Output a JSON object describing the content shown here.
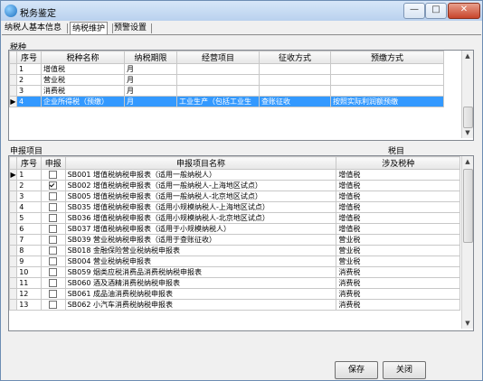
{
  "window": {
    "title": "税务鉴定",
    "min": "—",
    "max": "□",
    "close": "✕"
  },
  "tabs": [
    "纳税人基本信息",
    "纳税维护",
    "预警设置"
  ],
  "tax_section_label": "税种",
  "tax_table": {
    "headers": [
      "序号",
      "税种名称",
      "纳税期限",
      "经营项目",
      "征收方式",
      "预缴方式"
    ],
    "rows": [
      {
        "no": "1",
        "name": "增值税",
        "period": "月",
        "business": "",
        "collection": "",
        "prepay": ""
      },
      {
        "no": "2",
        "name": "营业税",
        "period": "月",
        "business": "",
        "collection": "",
        "prepay": ""
      },
      {
        "no": "3",
        "name": "消费税",
        "period": "月",
        "business": "",
        "collection": "",
        "prepay": ""
      },
      {
        "no": "4",
        "name": "企业所得税（预缴）",
        "period": "月",
        "business": "工业生产（包括工业生",
        "collection": "查账征收",
        "prepay": "按照实际利润额预缴"
      }
    ]
  },
  "declare_section_label": "申报项目",
  "declare_section_right_label": "税目",
  "declare_table": {
    "headers": [
      "序号",
      "申报",
      "申报项目名称",
      "涉及税种"
    ],
    "rows": [
      {
        "no": "1",
        "checked": false,
        "name": "SB001 增值税纳税申报表（适用一般纳税人）",
        "tax": "增值税"
      },
      {
        "no": "2",
        "checked": true,
        "name": "SB002 增值税纳税申报表（适用一般纳税人-上海地区试点）",
        "tax": "增值税"
      },
      {
        "no": "3",
        "checked": false,
        "name": "SB005 增值税纳税申报表（适用一般纳税人-北京地区试点）",
        "tax": "增值税"
      },
      {
        "no": "4",
        "checked": false,
        "name": "SB035 增值税纳税申报表（适用小规模纳税人-上海地区试点）",
        "tax": "增值税"
      },
      {
        "no": "5",
        "checked": false,
        "name": "SB036 增值税纳税申报表（适用小规模纳税人-北京地区试点）",
        "tax": "增值税"
      },
      {
        "no": "6",
        "checked": false,
        "name": "SB037 增值税纳税申报表（适用于小规模纳税人）",
        "tax": "增值税"
      },
      {
        "no": "7",
        "checked": false,
        "name": "SB039 营业税纳税申报表（适用于查账征收）",
        "tax": "营业税"
      },
      {
        "no": "8",
        "checked": false,
        "name": "SB018 金融保险营业税纳税申报表",
        "tax": "营业税"
      },
      {
        "no": "9",
        "checked": false,
        "name": "SB004 营业税纳税申报表",
        "tax": "营业税"
      },
      {
        "no": "10",
        "checked": false,
        "name": "SB059 烟类应税消费品消费税纳税申报表",
        "tax": "消费税"
      },
      {
        "no": "11",
        "checked": false,
        "name": "SB060 酒及酒精消费税纳税申报表",
        "tax": "消费税"
      },
      {
        "no": "12",
        "checked": false,
        "name": "SB061 成品油消费税纳税申报表",
        "tax": "消费税"
      },
      {
        "no": "13",
        "checked": false,
        "name": "SB062 小汽车消费税纳税申报表",
        "tax": "消费税"
      }
    ]
  },
  "buttons": {
    "save": "保存",
    "close": "关闭"
  }
}
